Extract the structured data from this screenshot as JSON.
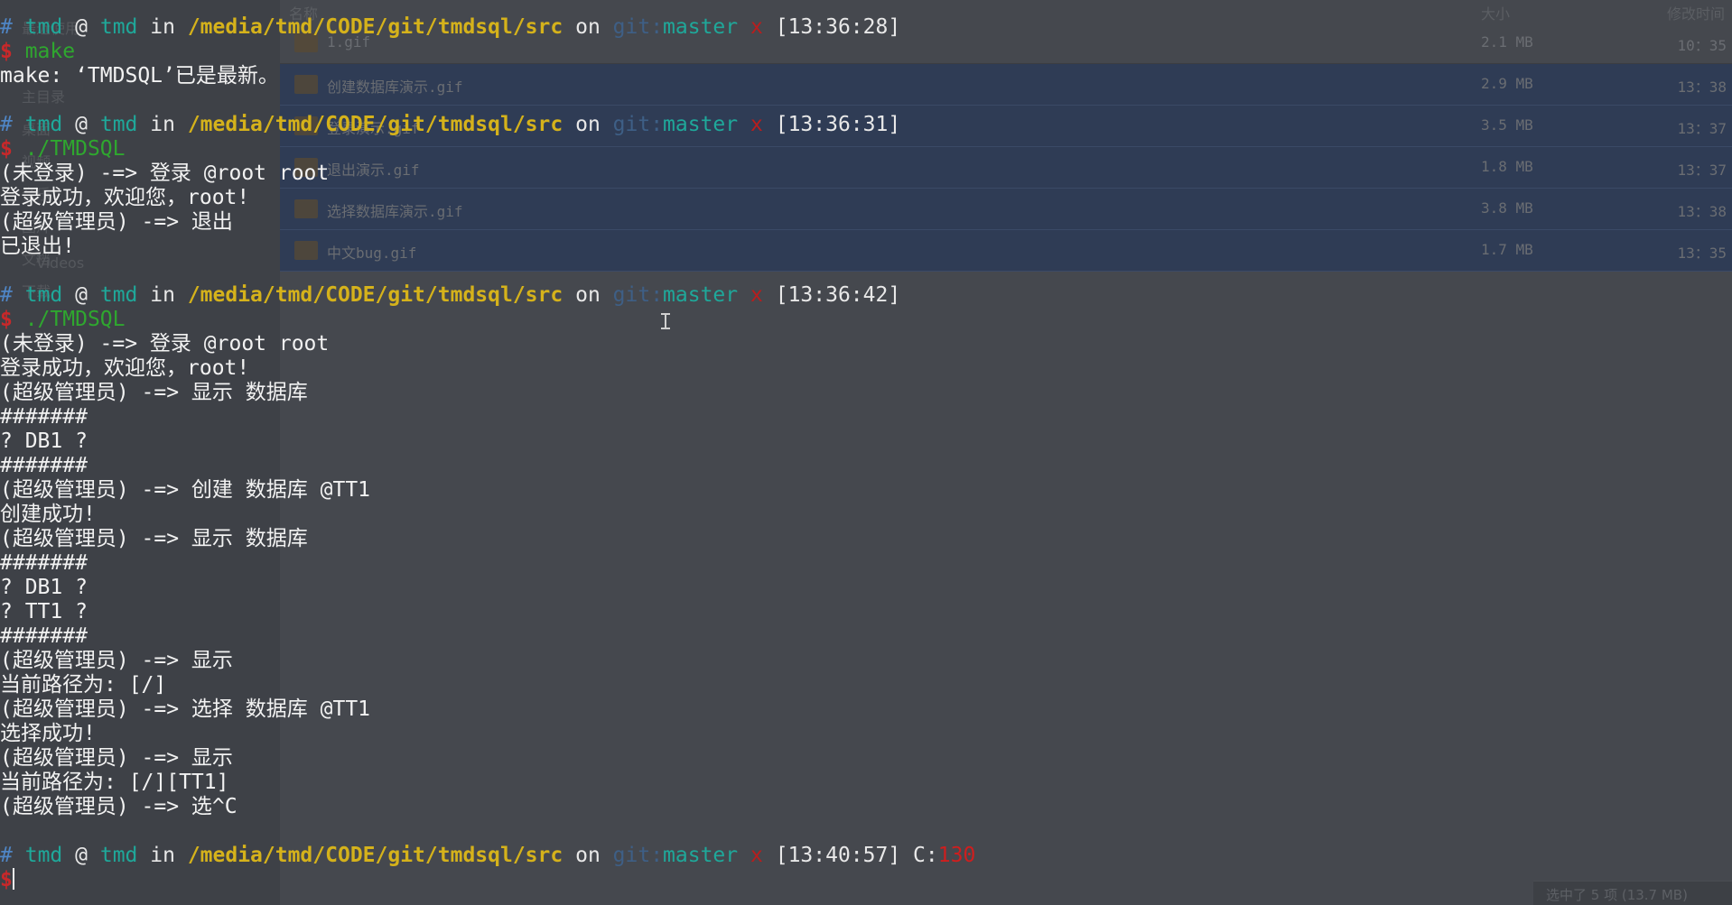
{
  "file_manager": {
    "header": {
      "name_col": "名称",
      "size_col": "大小",
      "time_col": "修改时间"
    },
    "sidebar": [
      "最近使用",
      "主目录",
      "桌面",
      "视频",
      "音乐",
      "图片",
      "文档",
      "下载",
      "Videos"
    ],
    "rows": [
      {
        "name": "1.gif",
        "size": "2.1 MB",
        "time": "10：35",
        "selected": false
      },
      {
        "name": "创建数据库演示.gif",
        "size": "2.9 MB",
        "time": "13：38",
        "selected": true
      },
      {
        "name": "登录演示.gif",
        "size": "3.5 MB",
        "time": "13：37",
        "selected": true
      },
      {
        "name": "退出演示.gif",
        "size": "1.8 MB",
        "time": "13：37",
        "selected": true
      },
      {
        "name": "选择数据库演示.gif",
        "size": "3.8 MB",
        "time": "13：38",
        "selected": true
      },
      {
        "name": "中文bug.gif",
        "size": "1.7 MB",
        "time": "13：35",
        "selected": true
      }
    ],
    "status": "选中了 5 项 (13.7 MB)"
  },
  "colors": {
    "background": "#41444b",
    "prompt_hash": "#4f86c6",
    "user_host": "#1fa89a",
    "path": "#d5b21b",
    "git_label": "#3e5f86",
    "dirty_x": "#b91d1d",
    "dollar": "#c8282a",
    "command": "#2fa72f",
    "text": "#f2f2f2"
  },
  "terminal": {
    "prompts": [
      {
        "hash": "#",
        "user": "tmd",
        "at": "@",
        "host": "tmd",
        "in": "in",
        "path": "/media/tmd/CODE/git/tmdsql/src",
        "on": "on",
        "git_label": "git:",
        "branch": "master",
        "dirty": "x",
        "time": "[13:36:28]",
        "dollar": "$",
        "command": " make"
      },
      {
        "hash": "#",
        "user": "tmd",
        "at": "@",
        "host": "tmd",
        "in": "in",
        "path": "/media/tmd/CODE/git/tmdsql/src",
        "on": "on",
        "git_label": "git:",
        "branch": "master",
        "dirty": "x",
        "time": "[13:36:31]",
        "dollar": "$",
        "command": " ./TMDSQL"
      },
      {
        "hash": "#",
        "user": "tmd",
        "at": "@",
        "host": "tmd",
        "in": "in",
        "path": "/media/tmd/CODE/git/tmdsql/src",
        "on": "on",
        "git_label": "git:",
        "branch": "master",
        "dirty": "x",
        "time": "[13:36:42]",
        "dollar": "$",
        "command": " ./TMDSQL"
      },
      {
        "hash": "#",
        "user": "tmd",
        "at": "@",
        "host": "tmd",
        "in": "in",
        "path": "/media/tmd/CODE/git/tmdsql/src",
        "on": "on",
        "git_label": "git:",
        "branch": "master",
        "dirty": "x",
        "time": "[13:40:57]",
        "exit_label": " C:",
        "exit_code": "130",
        "dollar": "$",
        "command": ""
      }
    ],
    "output": {
      "make_result": "make: ‘TMDSQL’已是最新。",
      "s2": [
        "(未登录) -=> 登录 @root root",
        "登录成功，欢迎您，root!",
        "(超级管理员) -=> 退出",
        "已退出!"
      ],
      "s3": [
        "(未登录) -=> 登录 @root root",
        "登录成功，欢迎您，root!",
        "(超级管理员) -=> 显示 数据库",
        "#######",
        "? DB1 ?",
        "#######",
        "(超级管理员) -=> 创建 数据库 @TT1",
        "创建成功!",
        "(超级管理员) -=> 显示 数据库",
        "#######",
        "? DB1 ?",
        "? TT1 ?",
        "#######",
        "(超级管理员) -=> 显示",
        "当前路径为: [/]",
        "(超级管理员) -=> 选择 数据库 @TT1",
        "选择成功!",
        "(超级管理员) -=> 显示",
        "当前路径为: [/][TT1]",
        "(超级管理员) -=> 选^C"
      ]
    }
  }
}
